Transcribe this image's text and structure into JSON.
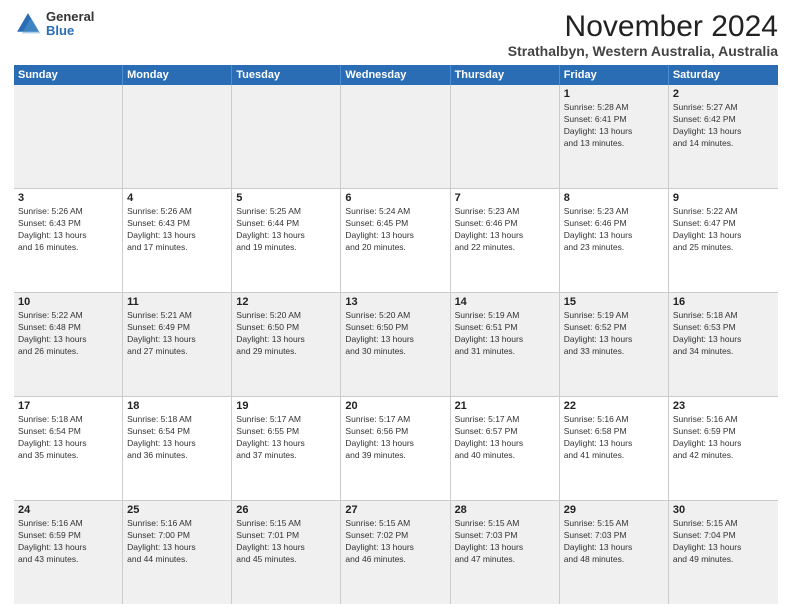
{
  "logo": {
    "general": "General",
    "blue": "Blue"
  },
  "title": {
    "main": "November 2024",
    "sub": "Strathalbyn, Western Australia, Australia"
  },
  "weekdays": [
    "Sunday",
    "Monday",
    "Tuesday",
    "Wednesday",
    "Thursday",
    "Friday",
    "Saturday"
  ],
  "weeks": [
    [
      {
        "day": "",
        "info": ""
      },
      {
        "day": "",
        "info": ""
      },
      {
        "day": "",
        "info": ""
      },
      {
        "day": "",
        "info": ""
      },
      {
        "day": "",
        "info": ""
      },
      {
        "day": "1",
        "info": "Sunrise: 5:28 AM\nSunset: 6:41 PM\nDaylight: 13 hours\nand 13 minutes."
      },
      {
        "day": "2",
        "info": "Sunrise: 5:27 AM\nSunset: 6:42 PM\nDaylight: 13 hours\nand 14 minutes."
      }
    ],
    [
      {
        "day": "3",
        "info": "Sunrise: 5:26 AM\nSunset: 6:43 PM\nDaylight: 13 hours\nand 16 minutes."
      },
      {
        "day": "4",
        "info": "Sunrise: 5:26 AM\nSunset: 6:43 PM\nDaylight: 13 hours\nand 17 minutes."
      },
      {
        "day": "5",
        "info": "Sunrise: 5:25 AM\nSunset: 6:44 PM\nDaylight: 13 hours\nand 19 minutes."
      },
      {
        "day": "6",
        "info": "Sunrise: 5:24 AM\nSunset: 6:45 PM\nDaylight: 13 hours\nand 20 minutes."
      },
      {
        "day": "7",
        "info": "Sunrise: 5:23 AM\nSunset: 6:46 PM\nDaylight: 13 hours\nand 22 minutes."
      },
      {
        "day": "8",
        "info": "Sunrise: 5:23 AM\nSunset: 6:46 PM\nDaylight: 13 hours\nand 23 minutes."
      },
      {
        "day": "9",
        "info": "Sunrise: 5:22 AM\nSunset: 6:47 PM\nDaylight: 13 hours\nand 25 minutes."
      }
    ],
    [
      {
        "day": "10",
        "info": "Sunrise: 5:22 AM\nSunset: 6:48 PM\nDaylight: 13 hours\nand 26 minutes."
      },
      {
        "day": "11",
        "info": "Sunrise: 5:21 AM\nSunset: 6:49 PM\nDaylight: 13 hours\nand 27 minutes."
      },
      {
        "day": "12",
        "info": "Sunrise: 5:20 AM\nSunset: 6:50 PM\nDaylight: 13 hours\nand 29 minutes."
      },
      {
        "day": "13",
        "info": "Sunrise: 5:20 AM\nSunset: 6:50 PM\nDaylight: 13 hours\nand 30 minutes."
      },
      {
        "day": "14",
        "info": "Sunrise: 5:19 AM\nSunset: 6:51 PM\nDaylight: 13 hours\nand 31 minutes."
      },
      {
        "day": "15",
        "info": "Sunrise: 5:19 AM\nSunset: 6:52 PM\nDaylight: 13 hours\nand 33 minutes."
      },
      {
        "day": "16",
        "info": "Sunrise: 5:18 AM\nSunset: 6:53 PM\nDaylight: 13 hours\nand 34 minutes."
      }
    ],
    [
      {
        "day": "17",
        "info": "Sunrise: 5:18 AM\nSunset: 6:54 PM\nDaylight: 13 hours\nand 35 minutes."
      },
      {
        "day": "18",
        "info": "Sunrise: 5:18 AM\nSunset: 6:54 PM\nDaylight: 13 hours\nand 36 minutes."
      },
      {
        "day": "19",
        "info": "Sunrise: 5:17 AM\nSunset: 6:55 PM\nDaylight: 13 hours\nand 37 minutes."
      },
      {
        "day": "20",
        "info": "Sunrise: 5:17 AM\nSunset: 6:56 PM\nDaylight: 13 hours\nand 39 minutes."
      },
      {
        "day": "21",
        "info": "Sunrise: 5:17 AM\nSunset: 6:57 PM\nDaylight: 13 hours\nand 40 minutes."
      },
      {
        "day": "22",
        "info": "Sunrise: 5:16 AM\nSunset: 6:58 PM\nDaylight: 13 hours\nand 41 minutes."
      },
      {
        "day": "23",
        "info": "Sunrise: 5:16 AM\nSunset: 6:59 PM\nDaylight: 13 hours\nand 42 minutes."
      }
    ],
    [
      {
        "day": "24",
        "info": "Sunrise: 5:16 AM\nSunset: 6:59 PM\nDaylight: 13 hours\nand 43 minutes."
      },
      {
        "day": "25",
        "info": "Sunrise: 5:16 AM\nSunset: 7:00 PM\nDaylight: 13 hours\nand 44 minutes."
      },
      {
        "day": "26",
        "info": "Sunrise: 5:15 AM\nSunset: 7:01 PM\nDaylight: 13 hours\nand 45 minutes."
      },
      {
        "day": "27",
        "info": "Sunrise: 5:15 AM\nSunset: 7:02 PM\nDaylight: 13 hours\nand 46 minutes."
      },
      {
        "day": "28",
        "info": "Sunrise: 5:15 AM\nSunset: 7:03 PM\nDaylight: 13 hours\nand 47 minutes."
      },
      {
        "day": "29",
        "info": "Sunrise: 5:15 AM\nSunset: 7:03 PM\nDaylight: 13 hours\nand 48 minutes."
      },
      {
        "day": "30",
        "info": "Sunrise: 5:15 AM\nSunset: 7:04 PM\nDaylight: 13 hours\nand 49 minutes."
      }
    ]
  ]
}
